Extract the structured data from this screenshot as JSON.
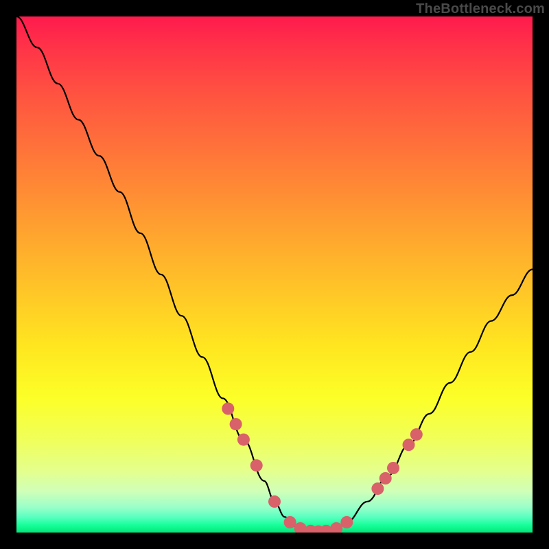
{
  "watermark": "TheBottleneck.com",
  "chart_data": {
    "type": "line",
    "title": "",
    "xlabel": "",
    "ylabel": "",
    "xlim": [
      0,
      100
    ],
    "ylim": [
      0,
      100
    ],
    "series": [
      {
        "name": "bottleneck-curve",
        "x": [
          0,
          4,
          8,
          12,
          16,
          20,
          24,
          28,
          32,
          36,
          40,
          44,
          48,
          50,
          52,
          54,
          56,
          58,
          60,
          62,
          64,
          68,
          72,
          76,
          80,
          84,
          88,
          92,
          96,
          100
        ],
        "y": [
          100,
          94,
          87,
          80,
          73,
          66,
          58,
          50,
          42,
          34,
          26,
          18,
          10,
          6,
          3,
          1.2,
          0.4,
          0.2,
          0.3,
          0.8,
          2,
          6,
          11,
          17,
          23,
          29,
          35,
          41,
          46,
          51
        ]
      }
    ],
    "markers": {
      "name": "highlight-dots",
      "color": "#d9616a",
      "radius": 9,
      "points": [
        {
          "x": 41.0,
          "y": 24.0
        },
        {
          "x": 42.5,
          "y": 21.0
        },
        {
          "x": 44.0,
          "y": 18.0
        },
        {
          "x": 46.5,
          "y": 13.0
        },
        {
          "x": 50.0,
          "y": 6.0
        },
        {
          "x": 53.0,
          "y": 2.0
        },
        {
          "x": 55.0,
          "y": 0.8
        },
        {
          "x": 57.0,
          "y": 0.3
        },
        {
          "x": 58.5,
          "y": 0.2
        },
        {
          "x": 60.0,
          "y": 0.3
        },
        {
          "x": 62.0,
          "y": 0.8
        },
        {
          "x": 64.0,
          "y": 2.0
        },
        {
          "x": 70.0,
          "y": 8.5
        },
        {
          "x": 71.5,
          "y": 10.5
        },
        {
          "x": 73.0,
          "y": 12.5
        },
        {
          "x": 76.0,
          "y": 17.0
        },
        {
          "x": 77.5,
          "y": 19.0
        }
      ]
    }
  }
}
